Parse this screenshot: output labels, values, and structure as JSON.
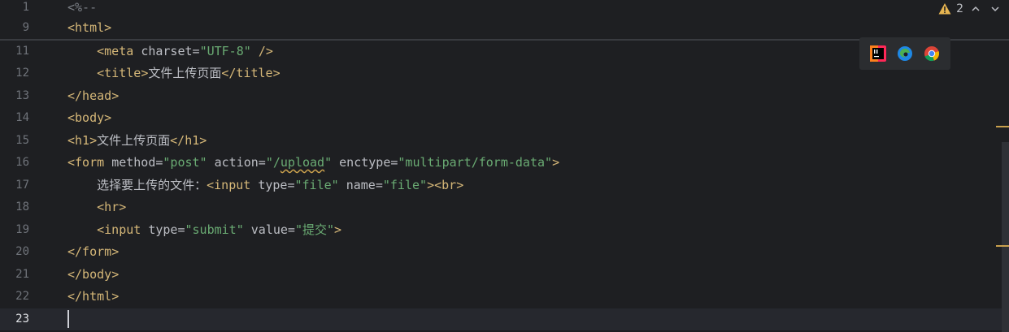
{
  "editor": {
    "sticky_lines": [
      {
        "number": "1",
        "text": "<%--"
      },
      {
        "number": "9",
        "text": "<html>"
      }
    ],
    "lines": [
      {
        "number": "11",
        "text": "    <meta charset=\"UTF-8\" />"
      },
      {
        "number": "12",
        "text": "    <title>文件上传页面</title>"
      },
      {
        "number": "13",
        "text": "</head>"
      },
      {
        "number": "14",
        "text": "<body>"
      },
      {
        "number": "15",
        "text": "<h1>文件上传页面</h1>"
      },
      {
        "number": "16",
        "text": "<form method=\"post\" action=\"/upload\" enctype=\"multipart/form-data\">"
      },
      {
        "number": "17",
        "text": "    选择要上传的文件：<input type=\"file\" name=\"file\"><br>"
      },
      {
        "number": "18",
        "text": "    <hr>"
      },
      {
        "number": "19",
        "text": "    <input type=\"submit\" value=\"提交\">"
      },
      {
        "number": "20",
        "text": "</form>"
      },
      {
        "number": "21",
        "text": "</body>"
      },
      {
        "number": "22",
        "text": "</html>"
      },
      {
        "number": "23",
        "text": ""
      }
    ]
  },
  "status": {
    "warning_count": "2",
    "warning_color": "#e6b450"
  },
  "browser_icons": [
    "intellij-idea-icon",
    "edge-icon",
    "chrome-icon"
  ],
  "colors": {
    "background": "#1e1f22",
    "tag": "#d5b778",
    "string": "#6aab73",
    "line_number": "#6f737a"
  }
}
